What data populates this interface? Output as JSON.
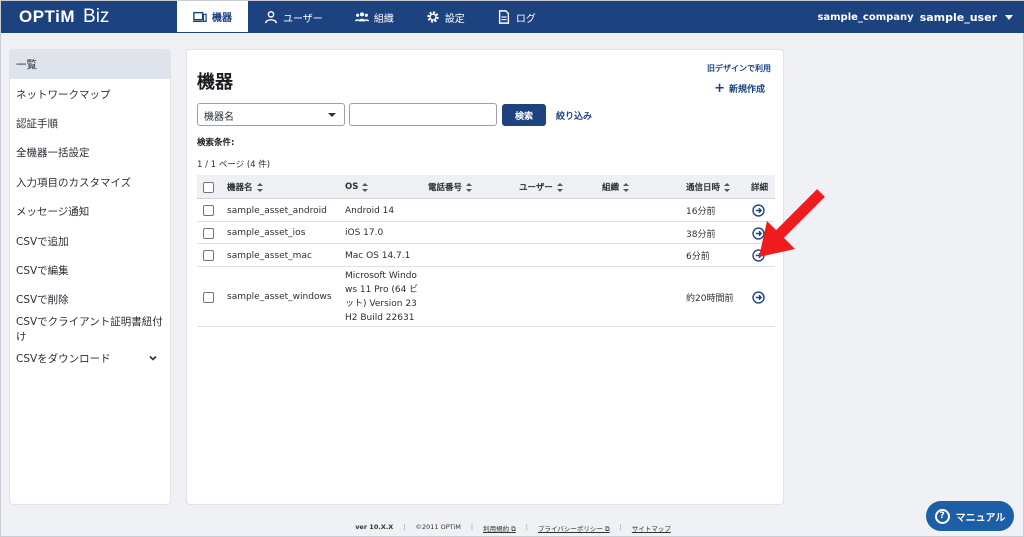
{
  "header": {
    "logo_brand": "OPTiM",
    "logo_product": "Biz",
    "nav": [
      {
        "label": "機器",
        "icon": "device-icon"
      },
      {
        "label": "ユーザー",
        "icon": "user-icon"
      },
      {
        "label": "組織",
        "icon": "organization-icon"
      },
      {
        "label": "設定",
        "icon": "gear-icon"
      },
      {
        "label": "ログ",
        "icon": "log-icon"
      }
    ],
    "active_nav": "機器",
    "company": "sample_company",
    "username": "sample_user"
  },
  "sidebar": {
    "items": [
      {
        "label": "一覧"
      },
      {
        "label": "ネットワークマップ"
      },
      {
        "label": "認証手順"
      },
      {
        "label": "全機器一括設定"
      },
      {
        "label": "入力項目のカスタマイズ"
      },
      {
        "label": "メッセージ通知"
      },
      {
        "label": "CSVで追加"
      },
      {
        "label": "CSVで編集"
      },
      {
        "label": "CSVで削除"
      },
      {
        "label": "CSVでクライアント証明書紐付け"
      },
      {
        "label": "CSVをダウンロード"
      }
    ]
  },
  "main": {
    "title": "機器",
    "legacy_link": "旧デザインで利用",
    "new_button": "新規作成",
    "search_field_select": "機器名",
    "search_input_value": "",
    "search_button": "検索",
    "filter_link": "絞り込み",
    "search_conditions_label": "検索条件:",
    "count_label": "1 / 1 ページ (4 件)",
    "columns": [
      "機器名",
      "OS",
      "電話番号",
      "ユーザー",
      "組織",
      "通信日時",
      "詳細"
    ],
    "rows": [
      {
        "name": "sample_asset_android",
        "os": "Android 14",
        "phone": "",
        "user": "",
        "org": "",
        "last_comm": "16分前"
      },
      {
        "name": "sample_asset_ios",
        "os": "iOS 17.0",
        "phone": "",
        "user": "",
        "org": "",
        "last_comm": "38分前"
      },
      {
        "name": "sample_asset_mac",
        "os": "Mac OS 14.7.1",
        "phone": "",
        "user": "",
        "org": "",
        "last_comm": "6分前"
      },
      {
        "name": "sample_asset_windows",
        "os": "Microsoft Windows 11 Pro (64 ビット) Version 23H2 Build 22631",
        "phone": "",
        "user": "",
        "org": "",
        "last_comm": "約20時間前"
      }
    ]
  },
  "footer": {
    "version": "ver 10.X.X",
    "copyright": "©2011 OPTiM",
    "terms": "利用規約",
    "privacy": "プライバシーポリシー",
    "sitemap": "サイトマップ"
  },
  "manual_button": "マニュアル",
  "colors": {
    "brand": "#1d4280",
    "annotation_arrow": "#ee1c1c"
  }
}
